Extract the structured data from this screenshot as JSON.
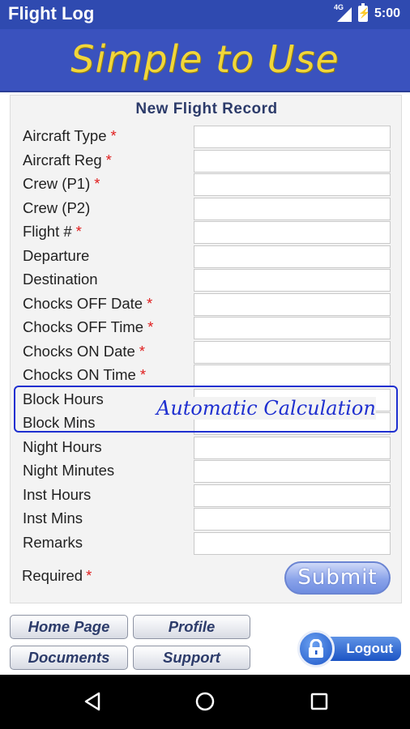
{
  "status_bar": {
    "app_title": "Flight Log",
    "network": "4G",
    "time": "5:00"
  },
  "banner": {
    "slogan": "Simple to Use"
  },
  "form": {
    "title": "New Flight Record",
    "fields": [
      {
        "label": "Aircraft Type",
        "required": true,
        "value": ""
      },
      {
        "label": "Aircraft Reg",
        "required": true,
        "value": ""
      },
      {
        "label": "Crew (P1)",
        "required": true,
        "value": ""
      },
      {
        "label": "Crew (P2)",
        "required": false,
        "value": ""
      },
      {
        "label": "Flight #",
        "required": true,
        "value": ""
      },
      {
        "label": "Departure",
        "required": false,
        "value": ""
      },
      {
        "label": "Destination",
        "required": false,
        "value": ""
      },
      {
        "label": "Chocks OFF Date",
        "required": true,
        "value": ""
      },
      {
        "label": "Chocks OFF Time",
        "required": true,
        "value": ""
      },
      {
        "label": "Chocks ON Date",
        "required": true,
        "value": ""
      },
      {
        "label": "Chocks ON Time",
        "required": true,
        "value": ""
      },
      {
        "label": "Block Hours",
        "required": false,
        "value": ""
      },
      {
        "label": "Block Mins",
        "required": false,
        "value": ""
      },
      {
        "label": "Night Hours",
        "required": false,
        "value": ""
      },
      {
        "label": "Night Minutes",
        "required": false,
        "value": ""
      },
      {
        "label": "Inst Hours",
        "required": false,
        "value": ""
      },
      {
        "label": "Inst Mins",
        "required": false,
        "value": ""
      },
      {
        "label": "Remarks",
        "required": false,
        "value": ""
      }
    ],
    "required_marker": "*",
    "required_label": "Required",
    "annotation": "Automatic Calculation",
    "submit_label": "Submit"
  },
  "nav": {
    "home": "Home Page",
    "profile": "Profile",
    "documents": "Documents",
    "support": "Support",
    "logout": "Logout"
  },
  "colors": {
    "header_blue": "#2f4ab0",
    "slogan_yellow": "#f1d63a",
    "required_red": "#e02020",
    "annotation_blue": "#1e2fd0"
  }
}
